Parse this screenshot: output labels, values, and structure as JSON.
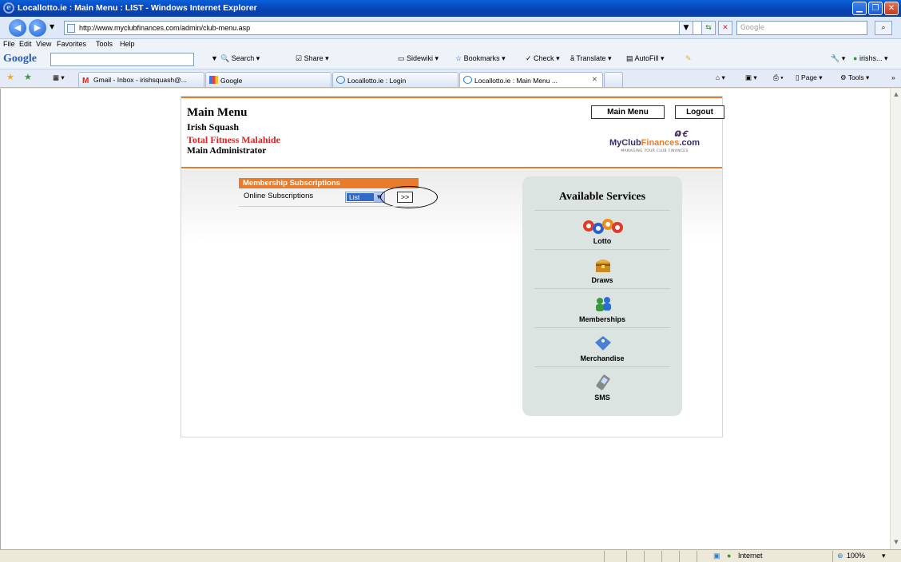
{
  "window": {
    "title": "Locallotto.ie : Main Menu : LIST - Windows Internet Explorer"
  },
  "address_bar": {
    "url": "http://www.myclubfinances.com/admin/club-menu.asp",
    "search_placeholder": "Google"
  },
  "menu_bar": [
    "File",
    "Edit",
    "View",
    "Favorites",
    "Tools",
    "Help"
  ],
  "google_toolbar": {
    "logo": "Google",
    "items": [
      "Search",
      "Share",
      "Sidewiki",
      "Bookmarks",
      "Check",
      "Translate",
      "AutoFill"
    ],
    "account": "irishs..."
  },
  "tabs": [
    {
      "label": "Gmail - Inbox - irishsquash@...",
      "icon": "gmail-icon"
    },
    {
      "label": "Google",
      "icon": "google-icon"
    },
    {
      "label": "Locallotto.ie : Login",
      "icon": "ie-page-icon"
    },
    {
      "label": "Locallotto.ie : Main Menu ...",
      "icon": "ie-page-icon",
      "active": true
    }
  ],
  "command_bar": {
    "page": "Page",
    "tools": "Tools"
  },
  "page": {
    "heading": "Main Menu",
    "org": "Irish Squash",
    "club": "Total Fitness Malahide",
    "role": "Main Administrator",
    "buttons": {
      "main_menu": "Main Menu",
      "logout": "Logout"
    },
    "logo": {
      "part1": "MyClub",
      "part2": "Finances",
      "part3": ".com",
      "tagline": "MANAGING YOUR CLUB FINANCES"
    },
    "subscriptions": {
      "header": "Membership Subscriptions",
      "label": "Online Subscriptions",
      "select_value": "List",
      "go_label": ">>"
    },
    "services": {
      "title": "Available Services",
      "items": [
        {
          "label": "Lotto",
          "icon": "lotto-balls-icon"
        },
        {
          "label": "Draws",
          "icon": "treasure-chest-icon"
        },
        {
          "label": "Memberships",
          "icon": "members-icon"
        },
        {
          "label": "Merchandise",
          "icon": "tag-icon"
        },
        {
          "label": "SMS",
          "icon": "phone-icon"
        }
      ]
    }
  },
  "status_bar": {
    "zone": "Internet",
    "zoom": "100%"
  }
}
